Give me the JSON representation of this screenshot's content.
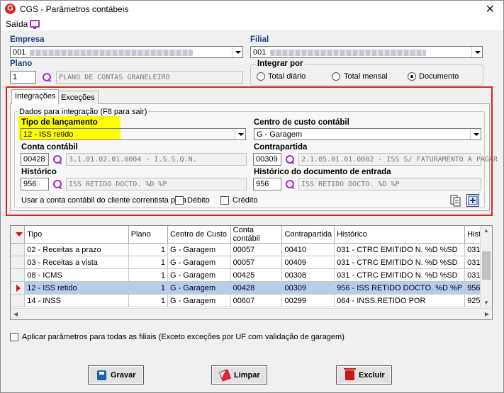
{
  "window": {
    "title": "CGS - Parâmetros contábeis",
    "close": "✕"
  },
  "menu": {
    "saida": "Saída"
  },
  "empresa": {
    "label": "Empresa",
    "value": "001"
  },
  "filial": {
    "label": "Filial",
    "value": "001"
  },
  "plano": {
    "label": "Plano",
    "code": "1",
    "desc": "PLANO DE CONTAS GRANELEIRO"
  },
  "integrar": {
    "label": "Integrar por",
    "options": [
      "Total diário",
      "Total mensal",
      "Documento"
    ],
    "selected": "Documento"
  },
  "tabs": [
    "Integrações",
    "Exceções"
  ],
  "dados": {
    "group_title": "Dados para integração (F8 para sair)",
    "tipo_label": "Tipo de lançamento",
    "tipo_value": "12 - ISS retido",
    "centro_label": "Centro de custo contábil",
    "centro_value": "G - Garagem",
    "conta_label": "Conta contábil",
    "conta_code": "00428",
    "conta_desc": "3.1.01.02.01.0004 - I.S.S.Q.N.",
    "contra_label": "Contrapartida",
    "contra_code": "00309",
    "contra_desc": "2.1.05.01.01.0002 - ISS S/ FATURAMENTO A PAGAR",
    "hist_label": "Histórico",
    "hist_code": "956",
    "hist_desc": "ISS RETIDO DOCTO. %D %P",
    "histdoc_label": "Histórico do documento de entrada",
    "histdoc_code": "956",
    "histdoc_desc": "ISS RETIDO DOCTO. %D %P",
    "usar_label": "Usar a conta contábil do cliente correntista para",
    "debito": "Débito",
    "credito": "Crédito"
  },
  "grid": {
    "columns": [
      "Tipo",
      "Plano",
      "Centro de Custo",
      "Conta contábil",
      "Contrapartida",
      "Histórico",
      "Hist"
    ],
    "rows": [
      [
        "02 - Receitas a prazo",
        "1",
        "G - Garagem",
        "00057",
        "00410",
        "031 - CTRC EMITIDO N. %D %SD",
        "031"
      ],
      [
        "03 - Receitas a vista",
        "1",
        "G - Garagem",
        "00057",
        "00409",
        "031 - CTRC EMITIDO N. %D %SD",
        "031"
      ],
      [
        "08 - ICMS",
        "1",
        "G - Garagem",
        "00425",
        "00308",
        "031 - CTRC EMITIDO N. %D %SD",
        "031"
      ],
      [
        "12 - ISS retido",
        "1",
        "G - Garagem",
        "00428",
        "00309",
        "956 - ISS RETIDO DOCTO. %D %P",
        "956"
      ],
      [
        "14 - INSS",
        "1",
        "G - Garagem",
        "00607",
        "00299",
        "064 - INSS.RETIDO POR",
        "925"
      ]
    ],
    "selected_row": 3
  },
  "aplicar_label": "Aplicar parâmetros para todas as filiais (Exceto exceções por UF com validação de garagem)",
  "buttons": {
    "gravar": "Gravar",
    "limpar": "Limpar",
    "excluir": "Excluir"
  },
  "colors": {
    "highlight": "#ffff00",
    "red_frame": "#e02020",
    "selected_row": "#b8cce8",
    "icon_purple": "#9b30d0"
  }
}
